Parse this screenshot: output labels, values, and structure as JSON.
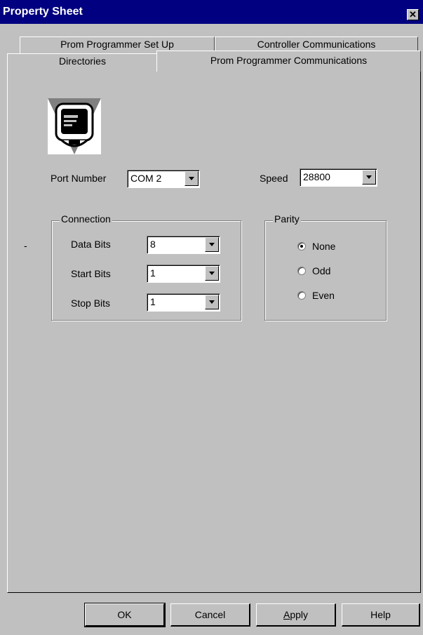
{
  "window": {
    "title": "Property Sheet",
    "close_glyph": "✕"
  },
  "tabs": {
    "row_back": [
      "Prom Programmer Set Up",
      "Controller Communications"
    ],
    "row_front": [
      "Directories",
      "Prom Programmer Communications"
    ],
    "active": "Prom Programmer Communications"
  },
  "icon": "monitor-icon",
  "port": {
    "label": "Port Number",
    "value": "COM 2"
  },
  "speed": {
    "label": "Speed",
    "value": "28800"
  },
  "connection": {
    "title": "Connection",
    "fields": [
      {
        "label": "Data Bits",
        "value": "8"
      },
      {
        "label": "Start Bits",
        "value": "1"
      },
      {
        "label": "Stop Bits",
        "value": "1"
      }
    ],
    "stray_mark": "-"
  },
  "parity": {
    "title": "Parity",
    "options": [
      "None",
      "Odd",
      "Even"
    ],
    "selected": "None"
  },
  "buttons": {
    "ok": "OK",
    "cancel": "Cancel",
    "apply_rest": "pply",
    "apply_mnemonic": "A",
    "help": "Help"
  }
}
